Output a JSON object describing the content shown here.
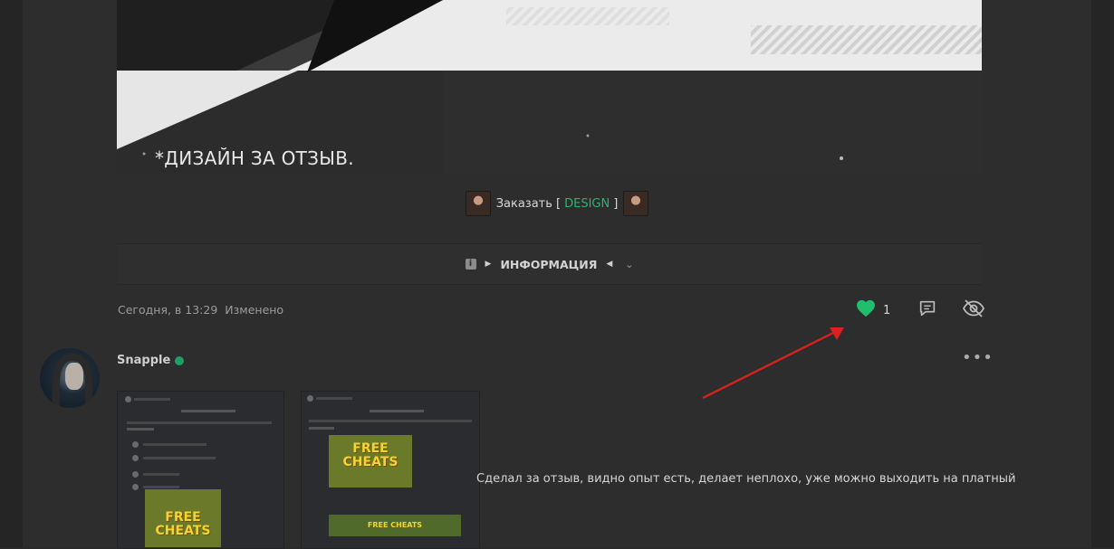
{
  "banner": {
    "title": "*ДИЗАЙН ЗА ОТЗЫВ."
  },
  "order": {
    "prefix": "Заказать [",
    "link": "DESIGN",
    "suffix": "]"
  },
  "spoiler": {
    "label": "ИНФОРМАЦИЯ"
  },
  "post_meta": {
    "time": "Сегодня, в 13:29",
    "edited": "Изменено"
  },
  "reactions": {
    "likes": "1"
  },
  "comment": {
    "username": "Snapple",
    "text": "Сделал за отзыв, видно опыт есть, делает неплохо, уже можно выходить на платный",
    "image1": {
      "banner_text": "FREE CHEATS"
    },
    "image2": {
      "banner_text": "FREE CHEATS",
      "wide_text": "FREE CHEATS"
    }
  },
  "colors": {
    "accent": "#22b872",
    "like": "#1fbf6e",
    "online": "#1f9f63",
    "annotation": "#e0201c"
  }
}
